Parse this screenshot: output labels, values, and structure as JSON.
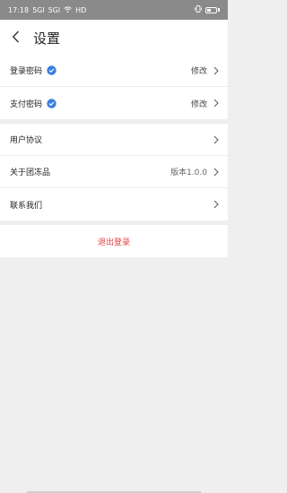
{
  "status_bar": {
    "time": "17:18",
    "signal_1": "5Gl",
    "signal_2": "5Gl",
    "hd": "HD"
  },
  "header": {
    "title": "设置"
  },
  "security": {
    "login_password": {
      "label": "登录密码",
      "action": "修改"
    },
    "payment_password": {
      "label": "支付密码",
      "action": "修改"
    }
  },
  "info": {
    "user_agreement": {
      "label": "用户协议"
    },
    "about": {
      "label": "关于团冻品",
      "version": "版本1.0.0"
    },
    "contact": {
      "label": "联系我们"
    }
  },
  "logout": {
    "label": "退出登录"
  },
  "colors": {
    "check_blue": "#3b7de0",
    "logout_red": "#e04040"
  }
}
